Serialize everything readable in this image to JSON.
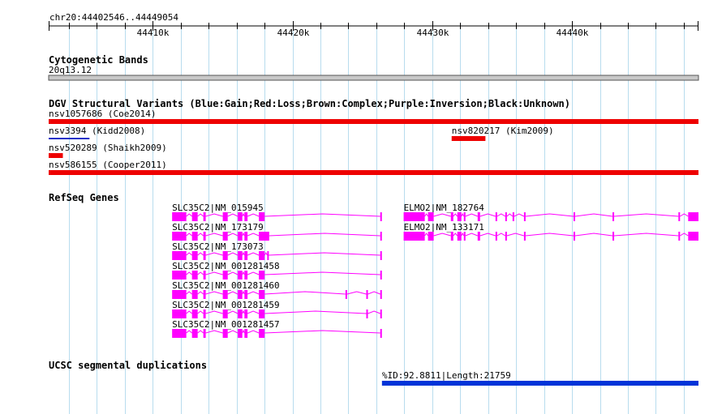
{
  "region": {
    "label": "chr20:44402546..44449054",
    "start": 44402546,
    "end": 44449054,
    "ticks": [
      {
        "value": 44410000,
        "label": "44410k"
      },
      {
        "value": 44420000,
        "label": "44420k"
      },
      {
        "value": 44430000,
        "label": "44430k"
      },
      {
        "value": 44440000,
        "label": "44440k"
      }
    ]
  },
  "colors": {
    "grid": "#b8dcee",
    "gain": "#1a30c8",
    "loss": "#ee0000",
    "gene": "#ff00ff",
    "segdup": "#0034d8",
    "band": "#c8c8c8"
  },
  "tracks": {
    "cytoband": {
      "title": "Cytogenetic Bands",
      "band_label": "20q13.12"
    },
    "dgv": {
      "title": "DGV Structural Variants (Blue:Gain;Red:Loss;Brown:Complex;Purple:Inversion;Black:Unknown)",
      "variants": [
        {
          "label": "nsv1057686 (Coe2014)",
          "type": "loss",
          "start": 44402546,
          "end": 44449054
        },
        {
          "label": "nsv3394 (Kidd2008)",
          "type": "gain",
          "start": 44402546,
          "end": 44405466
        },
        {
          "label": "nsv820217 (Kim2009)",
          "type": "loss",
          "start": 44431388,
          "end": 44433805
        },
        {
          "label": "nsv520289 (Shaikh2009)",
          "type": "loss",
          "start": 44402546,
          "end": 44403562
        },
        {
          "label": "nsv586155 (Cooper2011)",
          "type": "loss",
          "start": 44402546,
          "end": 44449054
        }
      ]
    },
    "refseq": {
      "title": "RefSeq Genes",
      "genes": [
        {
          "label": "SLC35C2|NM_015945",
          "start": 44411381,
          "end": 44426394,
          "exons": [
            [
              44411381,
              44412397
            ],
            [
              44412804,
              44413210
            ],
            [
              44413616,
              44413787
            ],
            [
              44415006,
              44415361
            ],
            [
              44416082,
              44416405
            ],
            [
              44416558,
              44416779
            ],
            [
              44417592,
              44418000
            ],
            [
              44426278,
              44426394
            ]
          ]
        },
        {
          "label": "SLC35C2|NM_173179",
          "start": 44411381,
          "end": 44426394,
          "exons": [
            [
              44411381,
              44412397
            ],
            [
              44412804,
              44413210
            ],
            [
              44413616,
              44413787
            ],
            [
              44415006,
              44415361
            ],
            [
              44416082,
              44416405
            ],
            [
              44416558,
              44416779
            ],
            [
              44417592,
              44418329
            ],
            [
              44426278,
              44426394
            ]
          ]
        },
        {
          "label": "SLC35C2|NM_173073",
          "start": 44411381,
          "end": 44426394,
          "exons": [
            [
              44411381,
              44412397
            ],
            [
              44412804,
              44413210
            ],
            [
              44413616,
              44413787
            ],
            [
              44415006,
              44415361
            ],
            [
              44416082,
              44416405
            ],
            [
              44416558,
              44416779
            ],
            [
              44417592,
              44418000
            ],
            [
              44418187,
              44418272
            ],
            [
              44426278,
              44426394
            ]
          ]
        },
        {
          "label": "SLC35C2|NM_001281458",
          "start": 44411381,
          "end": 44426394,
          "exons": [
            [
              44411381,
              44412397
            ],
            [
              44412804,
              44413210
            ],
            [
              44413616,
              44413787
            ],
            [
              44415006,
              44415361
            ],
            [
              44416082,
              44416405
            ],
            [
              44416558,
              44416779
            ],
            [
              44417592,
              44418000
            ],
            [
              44426278,
              44426394
            ]
          ]
        },
        {
          "label": "SLC35C2|NM_001281460",
          "start": 44411381,
          "end": 44426394,
          "exons": [
            [
              44411381,
              44412397
            ],
            [
              44412804,
              44413210
            ],
            [
              44413616,
              44413787
            ],
            [
              44415006,
              44415361
            ],
            [
              44416082,
              44416405
            ],
            [
              44416558,
              44416779
            ],
            [
              44417592,
              44418000
            ],
            [
              44423788,
              44423904
            ],
            [
              44425278,
              44425394
            ],
            [
              44426278,
              44426394
            ]
          ]
        },
        {
          "label": "SLC35C2|NM_001281459",
          "start": 44411381,
          "end": 44426394,
          "exons": [
            [
              44411381,
              44412397
            ],
            [
              44412804,
              44413210
            ],
            [
              44413616,
              44413787
            ],
            [
              44415006,
              44415361
            ],
            [
              44416082,
              44416405
            ],
            [
              44416558,
              44416779
            ],
            [
              44417592,
              44418000
            ],
            [
              44425278,
              44425394
            ],
            [
              44426278,
              44426394
            ]
          ]
        },
        {
          "label": "SLC35C2|NM_001281457",
          "start": 44411381,
          "end": 44426394,
          "exons": [
            [
              44411381,
              44412397
            ],
            [
              44412804,
              44413210
            ],
            [
              44413616,
              44413787
            ],
            [
              44415006,
              44415361
            ],
            [
              44416082,
              44416405
            ],
            [
              44416558,
              44416779
            ],
            [
              44417592,
              44418000
            ],
            [
              44426278,
              44426394
            ]
          ]
        },
        {
          "label": "ELMO2|NM_182764",
          "start": 44427952,
          "end": 44449054,
          "exons": [
            [
              44427952,
              44429464
            ],
            [
              44429696,
              44430103
            ],
            [
              44431331,
              44431505
            ],
            [
              44431795,
              44432086
            ],
            [
              44432261,
              44432377
            ],
            [
              44433249,
              44433423
            ],
            [
              44434528,
              44434644
            ],
            [
              44435226,
              44435342
            ],
            [
              44435749,
              44435865
            ],
            [
              44436564,
              44436680
            ],
            [
              44440111,
              44440227
            ],
            [
              44442902,
              44443018
            ],
            [
              44447619,
              44447735
            ],
            [
              44448317,
              44449054
            ]
          ]
        },
        {
          "label": "ELMO2|NM_133171",
          "start": 44427952,
          "end": 44449054,
          "exons": [
            [
              44427952,
              44429464
            ],
            [
              44429696,
              44430103
            ],
            [
              44431331,
              44431505
            ],
            [
              44431795,
              44432086
            ],
            [
              44432261,
              44432377
            ],
            [
              44433249,
              44433423
            ],
            [
              44434528,
              44434644
            ],
            [
              44435226,
              44435342
            ],
            [
              44436564,
              44436680
            ],
            [
              44440111,
              44440227
            ],
            [
              44442902,
              44443018
            ],
            [
              44447619,
              44447735
            ],
            [
              44448317,
              44449054
            ]
          ]
        }
      ]
    },
    "segdup": {
      "title": "UCSC segmental duplications",
      "label": "%ID:92.8811|Length:21759",
      "start": 44426400,
      "end": 44449054
    }
  }
}
